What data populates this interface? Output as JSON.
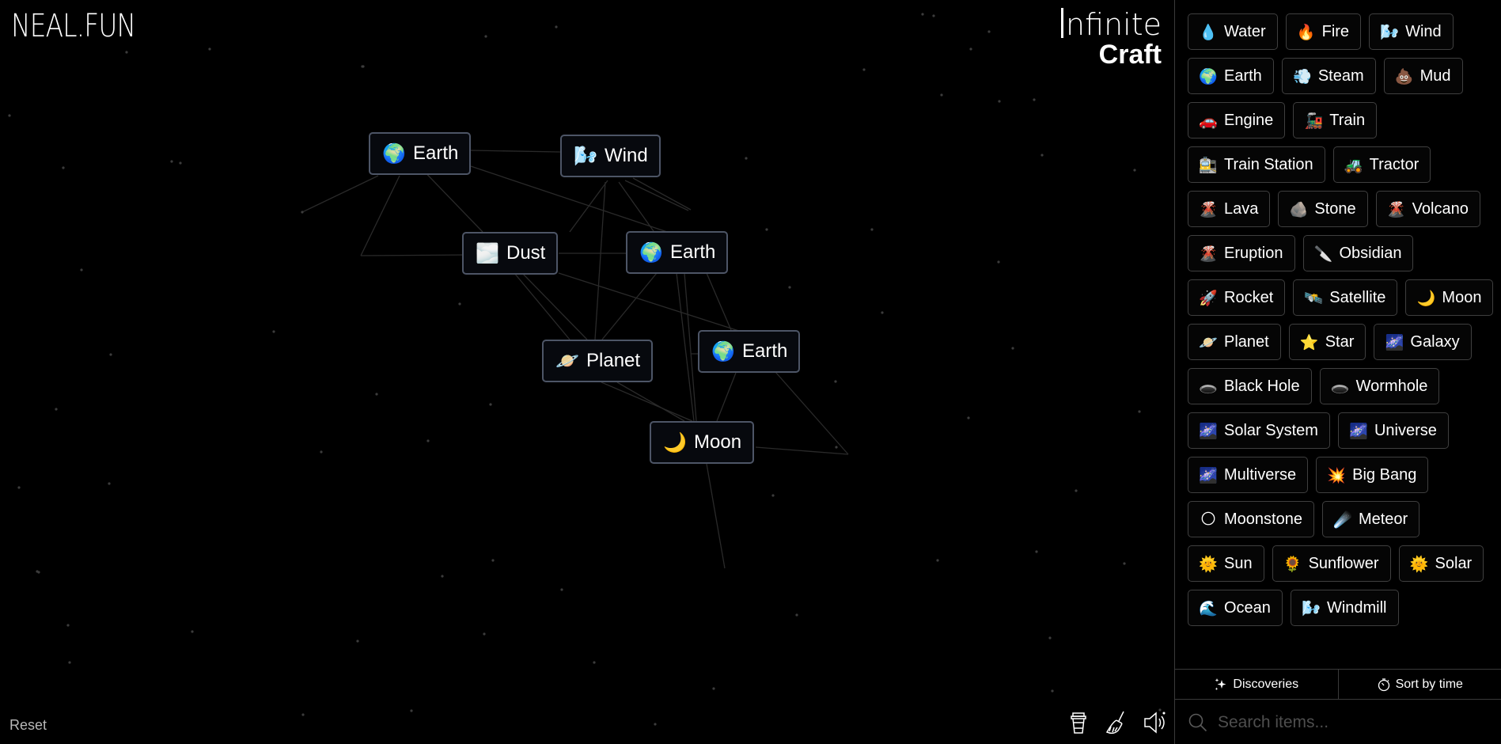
{
  "header": {
    "logo": "NEAL.FUN",
    "title_line1": "nfinite",
    "title_line2": "Craft"
  },
  "canvas": {
    "instances": [
      {
        "name": "Earth",
        "emoji": "🌍"
      },
      {
        "name": "Wind",
        "emoji": "🌬️"
      },
      {
        "name": "Dust",
        "emoji": "🌫️"
      },
      {
        "name": "Earth",
        "emoji": "🌍"
      },
      {
        "name": "Planet",
        "emoji": "🪐"
      },
      {
        "name": "Earth",
        "emoji": "🌍"
      },
      {
        "name": "Moon",
        "emoji": "🌙"
      }
    ],
    "reset_label": "Reset",
    "tools": [
      {
        "name": "coffee-icon"
      },
      {
        "name": "broom-icon"
      },
      {
        "name": "sound-icon"
      }
    ]
  },
  "sidebar": {
    "items": [
      {
        "name": "Water",
        "emoji": "💧"
      },
      {
        "name": "Fire",
        "emoji": "🔥"
      },
      {
        "name": "Wind",
        "emoji": "🌬️"
      },
      {
        "name": "Earth",
        "emoji": "🌍"
      },
      {
        "name": "Steam",
        "emoji": "💨"
      },
      {
        "name": "Mud",
        "emoji": "💩"
      },
      {
        "name": "Engine",
        "emoji": "🚗"
      },
      {
        "name": "Train",
        "emoji": "🚂"
      },
      {
        "name": "Train Station",
        "emoji": "🚉"
      },
      {
        "name": "Tractor",
        "emoji": "🚜"
      },
      {
        "name": "Lava",
        "emoji": "🌋"
      },
      {
        "name": "Stone",
        "emoji": "🪨"
      },
      {
        "name": "Volcano",
        "emoji": "🌋"
      },
      {
        "name": "Eruption",
        "emoji": "🌋"
      },
      {
        "name": "Obsidian",
        "emoji": "🔪"
      },
      {
        "name": "Rocket",
        "emoji": "🚀"
      },
      {
        "name": "Satellite",
        "emoji": "🛰️"
      },
      {
        "name": "Moon",
        "emoji": "🌙"
      },
      {
        "name": "Planet",
        "emoji": "🪐"
      },
      {
        "name": "Star",
        "emoji": "⭐"
      },
      {
        "name": "Galaxy",
        "emoji": "🌌"
      },
      {
        "name": "Black Hole",
        "emoji": "🕳️"
      },
      {
        "name": "Wormhole",
        "emoji": "🕳️"
      },
      {
        "name": "Solar System",
        "emoji": "🌌"
      },
      {
        "name": "Universe",
        "emoji": "🌌"
      },
      {
        "name": "Multiverse",
        "emoji": "🌌"
      },
      {
        "name": "Big Bang",
        "emoji": "💥"
      },
      {
        "name": "Moonstone",
        "emoji": "🌕"
      },
      {
        "name": "Meteor",
        "emoji": "☄️"
      },
      {
        "name": "Sun",
        "emoji": "🌞"
      },
      {
        "name": "Sunflower",
        "emoji": "🌻"
      },
      {
        "name": "Solar",
        "emoji": "🌞"
      },
      {
        "name": "Ocean",
        "emoji": "🌊"
      },
      {
        "name": "Windmill",
        "emoji": "🌬️"
      }
    ],
    "discoveries_label": "Discoveries",
    "sort_label": "Sort by time",
    "search_placeholder": "Search items..."
  }
}
